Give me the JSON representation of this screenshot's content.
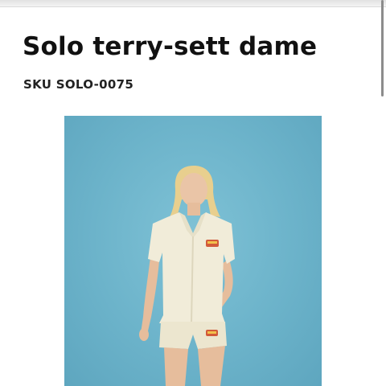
{
  "product": {
    "title": "Solo terry-sett dame",
    "sku_label": "SKU",
    "sku_code": "SOLO-0075"
  },
  "image": {
    "icon": "product-photo",
    "background_color": "#6cb3ca",
    "outfit_color": "#f1ecd9",
    "logo_text": "Solo"
  },
  "colors": {
    "text": "#111111",
    "page_background": "#ffffff"
  }
}
